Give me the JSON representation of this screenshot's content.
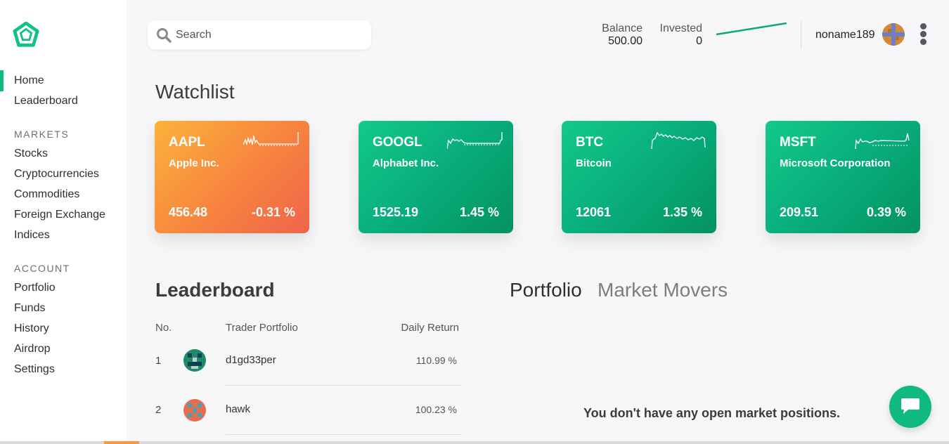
{
  "sidebar": {
    "items_main": [
      {
        "label": "Home",
        "active": true
      },
      {
        "label": "Leaderboard",
        "active": false
      }
    ],
    "markets_heading": "MARKETS",
    "markets": [
      "Stocks",
      "Cryptocurrencies",
      "Commodities",
      "Foreign Exchange",
      "Indices"
    ],
    "account_heading": "ACCOUNT",
    "account": [
      "Portfolio",
      "Funds",
      "History",
      "Airdrop",
      "Settings"
    ]
  },
  "header": {
    "search_placeholder": "Search",
    "balance_label": "Balance",
    "balance_value": "500.00",
    "invested_label": "Invested",
    "invested_value": "0",
    "username": "noname189"
  },
  "watchlist": {
    "title": "Watchlist",
    "cards": [
      {
        "symbol": "AAPL",
        "name": "Apple Inc.",
        "price": "456.48",
        "change": "-0.31 %",
        "trend": "down"
      },
      {
        "symbol": "GOOGL",
        "name": "Alphabet Inc.",
        "price": "1525.19",
        "change": "1.45 %",
        "trend": "up"
      },
      {
        "symbol": "BTC",
        "name": "Bitcoin",
        "price": "12061",
        "change": "1.35 %",
        "trend": "up"
      },
      {
        "symbol": "MSFT",
        "name": "Microsoft Corporation",
        "price": "209.51",
        "change": "0.39 %",
        "trend": "up"
      }
    ]
  },
  "leaderboard": {
    "title": "Leaderboard",
    "columns": [
      "No.",
      "Trader Portfolio",
      "Daily Return"
    ],
    "rows": [
      {
        "no": "1",
        "name": "d1gd33per",
        "return": "110.99 %"
      },
      {
        "no": "2",
        "name": "hawk",
        "return": "100.23 %"
      }
    ]
  },
  "portfolio": {
    "tabs": [
      "Portfolio",
      "Market Movers"
    ],
    "active_tab": "Portfolio",
    "empty_message": "You don't have any open market positions."
  },
  "colors": {
    "accent": "#0fba82",
    "up_card": "#07a876",
    "down_card": "#f7833f"
  },
  "icons": {
    "logo": "pentagon-logo-icon",
    "search": "search-icon",
    "menu": "kebab-menu-icon",
    "chat": "chat-icon"
  }
}
